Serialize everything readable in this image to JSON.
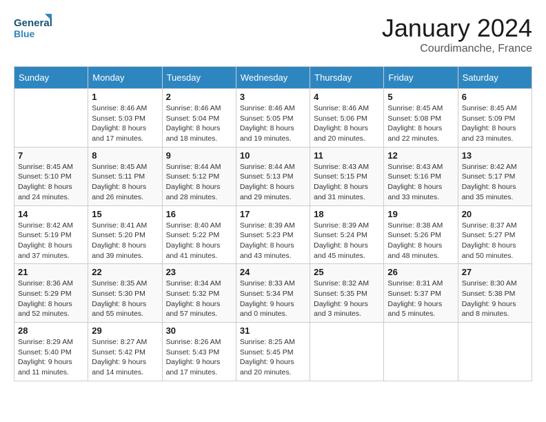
{
  "logo": {
    "line1": "General",
    "line2": "Blue"
  },
  "title": "January 2024",
  "location": "Courdimanche, France",
  "headers": [
    "Sunday",
    "Monday",
    "Tuesday",
    "Wednesday",
    "Thursday",
    "Friday",
    "Saturday"
  ],
  "weeks": [
    [
      {
        "day": "",
        "info": ""
      },
      {
        "day": "1",
        "info": "Sunrise: 8:46 AM\nSunset: 5:03 PM\nDaylight: 8 hours\nand 17 minutes."
      },
      {
        "day": "2",
        "info": "Sunrise: 8:46 AM\nSunset: 5:04 PM\nDaylight: 8 hours\nand 18 minutes."
      },
      {
        "day": "3",
        "info": "Sunrise: 8:46 AM\nSunset: 5:05 PM\nDaylight: 8 hours\nand 19 minutes."
      },
      {
        "day": "4",
        "info": "Sunrise: 8:46 AM\nSunset: 5:06 PM\nDaylight: 8 hours\nand 20 minutes."
      },
      {
        "day": "5",
        "info": "Sunrise: 8:45 AM\nSunset: 5:08 PM\nDaylight: 8 hours\nand 22 minutes."
      },
      {
        "day": "6",
        "info": "Sunrise: 8:45 AM\nSunset: 5:09 PM\nDaylight: 8 hours\nand 23 minutes."
      }
    ],
    [
      {
        "day": "7",
        "info": "Sunrise: 8:45 AM\nSunset: 5:10 PM\nDaylight: 8 hours\nand 24 minutes."
      },
      {
        "day": "8",
        "info": "Sunrise: 8:45 AM\nSunset: 5:11 PM\nDaylight: 8 hours\nand 26 minutes."
      },
      {
        "day": "9",
        "info": "Sunrise: 8:44 AM\nSunset: 5:12 PM\nDaylight: 8 hours\nand 28 minutes."
      },
      {
        "day": "10",
        "info": "Sunrise: 8:44 AM\nSunset: 5:13 PM\nDaylight: 8 hours\nand 29 minutes."
      },
      {
        "day": "11",
        "info": "Sunrise: 8:43 AM\nSunset: 5:15 PM\nDaylight: 8 hours\nand 31 minutes."
      },
      {
        "day": "12",
        "info": "Sunrise: 8:43 AM\nSunset: 5:16 PM\nDaylight: 8 hours\nand 33 minutes."
      },
      {
        "day": "13",
        "info": "Sunrise: 8:42 AM\nSunset: 5:17 PM\nDaylight: 8 hours\nand 35 minutes."
      }
    ],
    [
      {
        "day": "14",
        "info": "Sunrise: 8:42 AM\nSunset: 5:19 PM\nDaylight: 8 hours\nand 37 minutes."
      },
      {
        "day": "15",
        "info": "Sunrise: 8:41 AM\nSunset: 5:20 PM\nDaylight: 8 hours\nand 39 minutes."
      },
      {
        "day": "16",
        "info": "Sunrise: 8:40 AM\nSunset: 5:22 PM\nDaylight: 8 hours\nand 41 minutes."
      },
      {
        "day": "17",
        "info": "Sunrise: 8:39 AM\nSunset: 5:23 PM\nDaylight: 8 hours\nand 43 minutes."
      },
      {
        "day": "18",
        "info": "Sunrise: 8:39 AM\nSunset: 5:24 PM\nDaylight: 8 hours\nand 45 minutes."
      },
      {
        "day": "19",
        "info": "Sunrise: 8:38 AM\nSunset: 5:26 PM\nDaylight: 8 hours\nand 48 minutes."
      },
      {
        "day": "20",
        "info": "Sunrise: 8:37 AM\nSunset: 5:27 PM\nDaylight: 8 hours\nand 50 minutes."
      }
    ],
    [
      {
        "day": "21",
        "info": "Sunrise: 8:36 AM\nSunset: 5:29 PM\nDaylight: 8 hours\nand 52 minutes."
      },
      {
        "day": "22",
        "info": "Sunrise: 8:35 AM\nSunset: 5:30 PM\nDaylight: 8 hours\nand 55 minutes."
      },
      {
        "day": "23",
        "info": "Sunrise: 8:34 AM\nSunset: 5:32 PM\nDaylight: 8 hours\nand 57 minutes."
      },
      {
        "day": "24",
        "info": "Sunrise: 8:33 AM\nSunset: 5:34 PM\nDaylight: 9 hours\nand 0 minutes."
      },
      {
        "day": "25",
        "info": "Sunrise: 8:32 AM\nSunset: 5:35 PM\nDaylight: 9 hours\nand 3 minutes."
      },
      {
        "day": "26",
        "info": "Sunrise: 8:31 AM\nSunset: 5:37 PM\nDaylight: 9 hours\nand 5 minutes."
      },
      {
        "day": "27",
        "info": "Sunrise: 8:30 AM\nSunset: 5:38 PM\nDaylight: 9 hours\nand 8 minutes."
      }
    ],
    [
      {
        "day": "28",
        "info": "Sunrise: 8:29 AM\nSunset: 5:40 PM\nDaylight: 9 hours\nand 11 minutes."
      },
      {
        "day": "29",
        "info": "Sunrise: 8:27 AM\nSunset: 5:42 PM\nDaylight: 9 hours\nand 14 minutes."
      },
      {
        "day": "30",
        "info": "Sunrise: 8:26 AM\nSunset: 5:43 PM\nDaylight: 9 hours\nand 17 minutes."
      },
      {
        "day": "31",
        "info": "Sunrise: 8:25 AM\nSunset: 5:45 PM\nDaylight: 9 hours\nand 20 minutes."
      },
      {
        "day": "",
        "info": ""
      },
      {
        "day": "",
        "info": ""
      },
      {
        "day": "",
        "info": ""
      }
    ]
  ]
}
